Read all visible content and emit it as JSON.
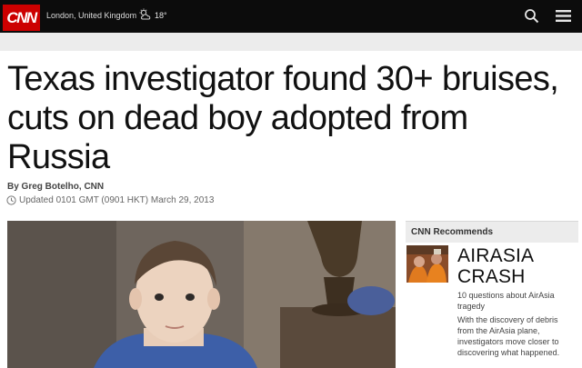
{
  "header": {
    "logo_text": "CNN",
    "location": "London, United Kingdom",
    "weather_icon": "partly-cloudy-icon",
    "temperature": "18°",
    "search_icon": "search-icon",
    "menu_icon": "menu-icon",
    "brand_color": "#cc0000"
  },
  "article": {
    "headline": "Texas investigator found 30+ bruises, cuts on dead boy adopted from Russia",
    "byline": "By Greg Botelho, CNN",
    "updated": "Updated 0101 GMT (0901 HKT) March 29, 2013"
  },
  "recommends": {
    "title": "CNN Recommends",
    "promo_title": "AIRASIA CRASH",
    "promo_subtitle": "10 questions about AirAsia tragedy",
    "promo_body": "With the discovery of debris from the AirAsia plane, investigators move closer to discovering what happened."
  }
}
